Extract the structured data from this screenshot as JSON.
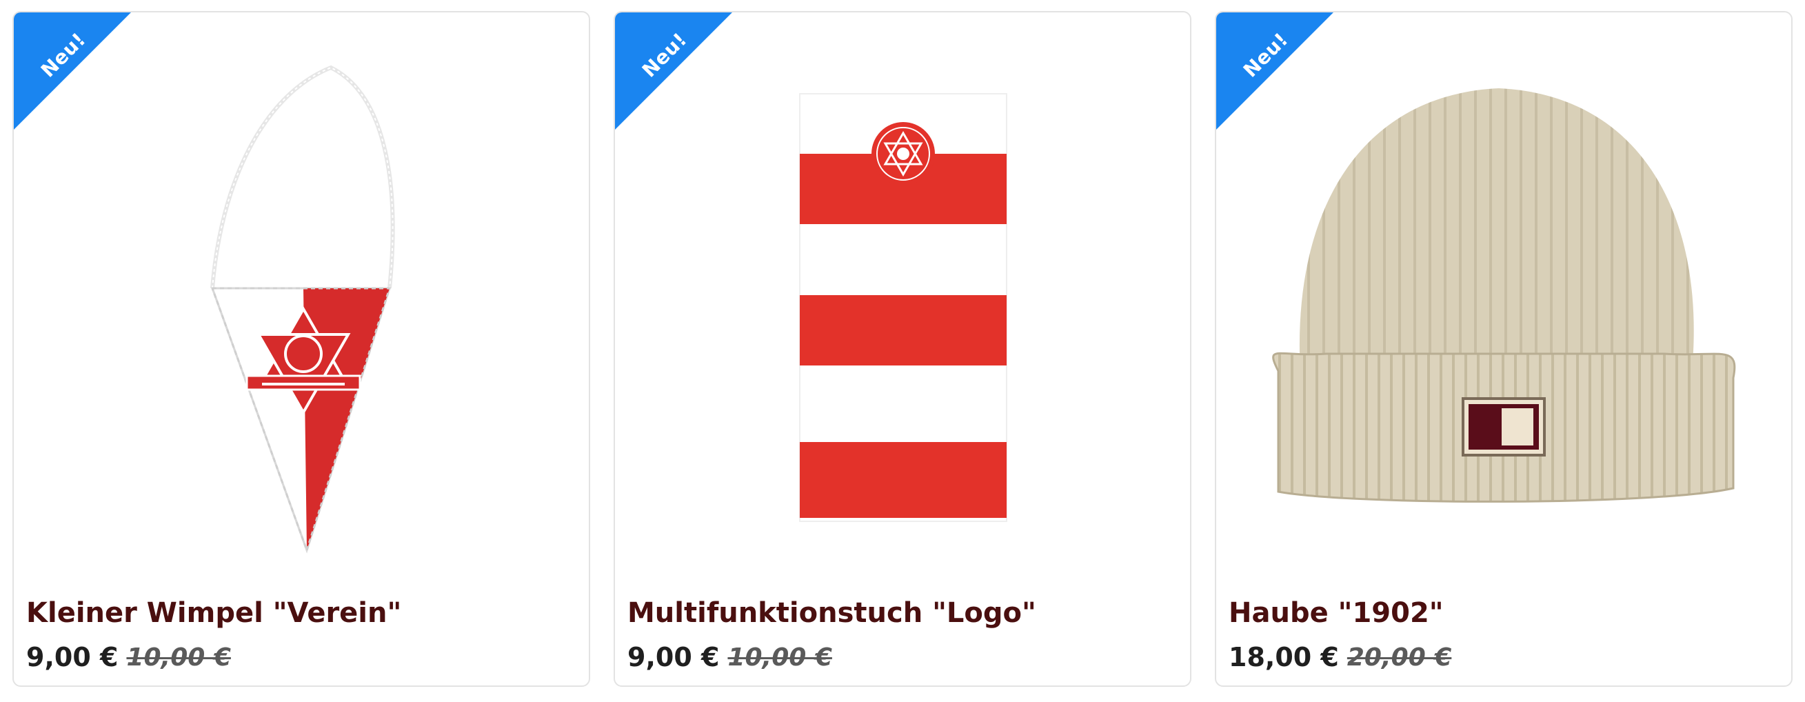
{
  "badge_color": "#1a85f0",
  "products": [
    {
      "badge": "Neu!",
      "title": "Kleiner Wimpel \"Verein\"",
      "price": "9,00 €",
      "old_price": "10,00 €",
      "image": "pennant-image"
    },
    {
      "badge": "Neu!",
      "title": "Multifunktionstuch \"Logo\"",
      "price": "9,00 €",
      "old_price": "10,00 €",
      "image": "striped-neck-gaiter-image"
    },
    {
      "badge": "Neu!",
      "title": "Haube \"1902\"",
      "price": "18,00 €",
      "old_price": "20,00 €",
      "image": "beige-beanie-image"
    }
  ]
}
